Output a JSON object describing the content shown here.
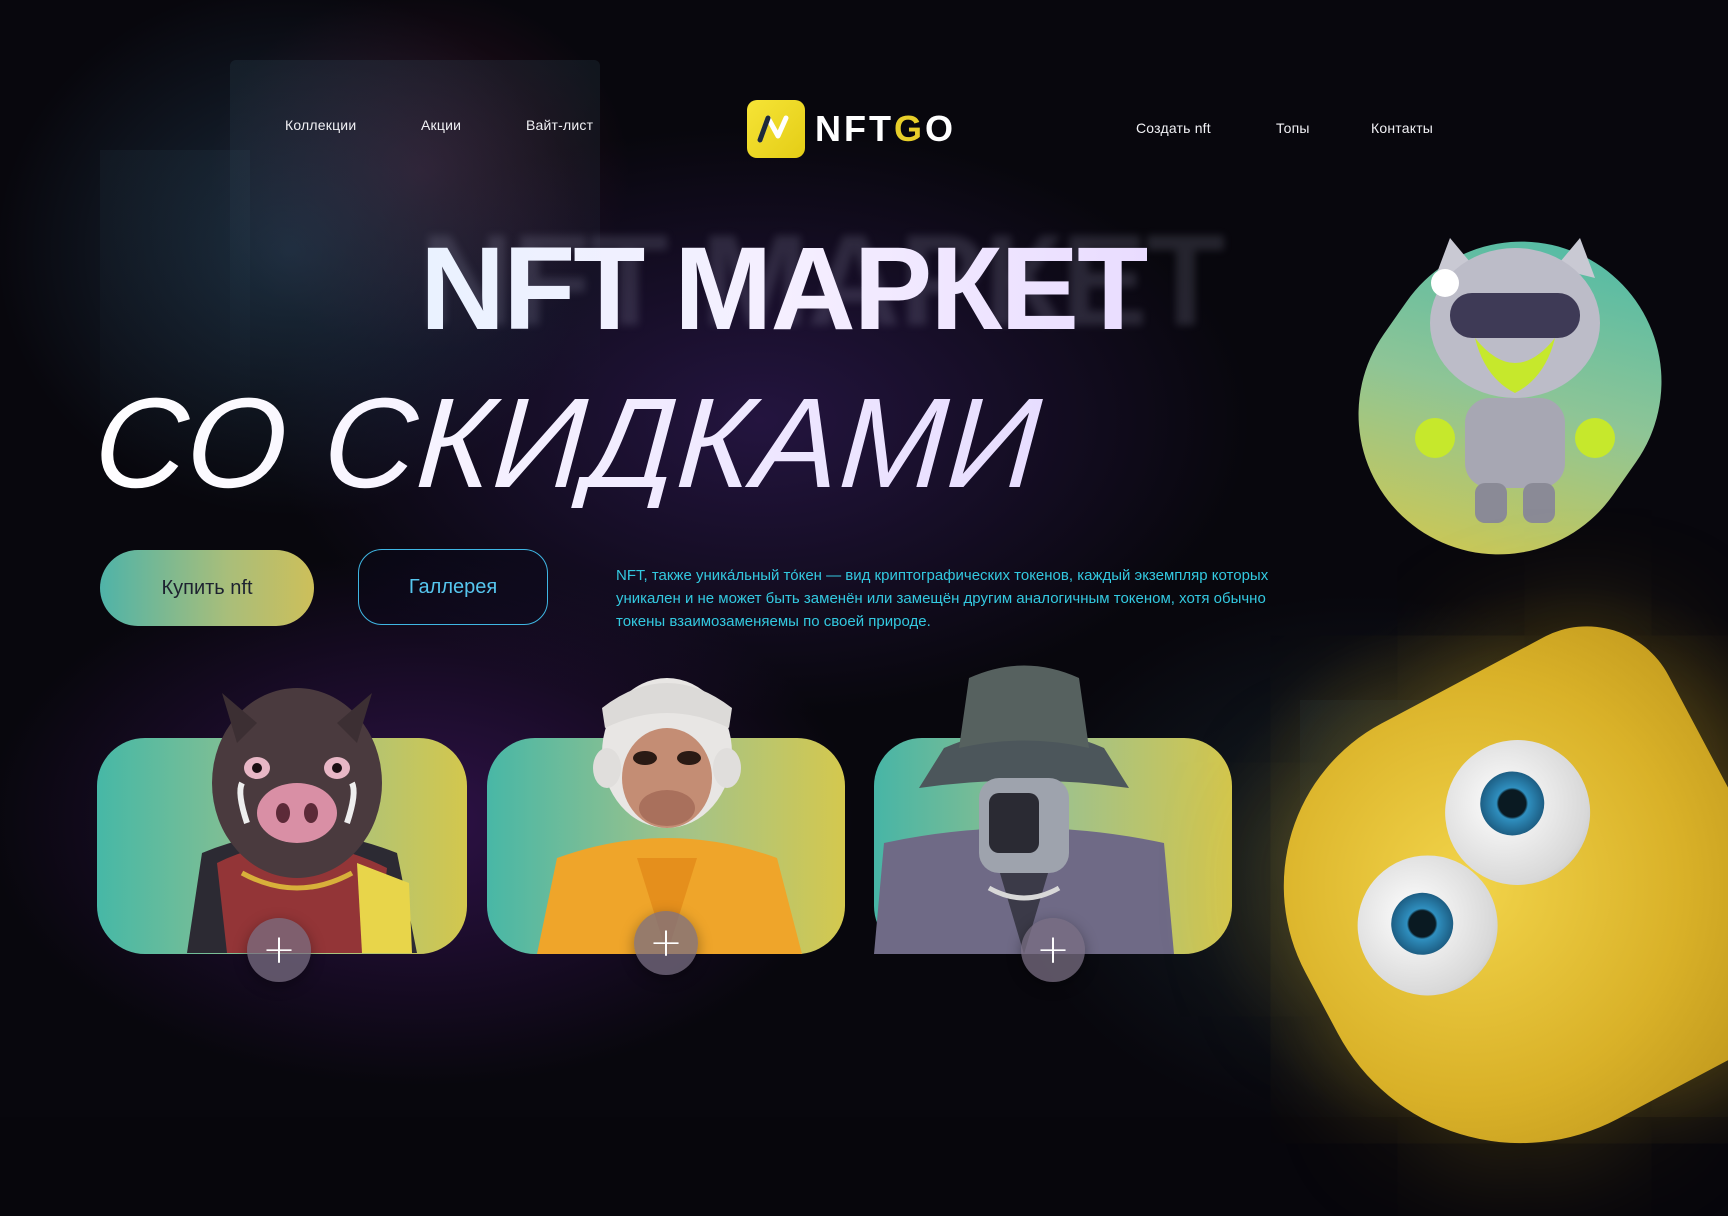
{
  "nav": {
    "left": [
      "Коллекции",
      "Акции",
      "Вайт-лист"
    ],
    "right": [
      "Создать nft",
      "Топы",
      "Контакты"
    ]
  },
  "logo": {
    "mark": "N",
    "text_prefix": "NFT",
    "text_g": "G",
    "text_suffix": "O",
    "accent": "#E8CF2A"
  },
  "hero": {
    "title_line1": "NFT МАРКЕТ",
    "title_line2": "СО СКИДКАМИ",
    "buy_label": "Купить nft",
    "gallery_label": "Галлерея",
    "description": "NFT, также уника́льный то́кен — вид криптографических токенов, каждый экземпляр которых уникален и не может быть заменён или замещён другим аналогичным токеном, хотя обычно токены взаимозаменяемы по своей природе."
  },
  "cards": [
    {
      "character": "boar-character",
      "plus": "+"
    },
    {
      "character": "ape-character",
      "plus": "+"
    },
    {
      "character": "robot-bucket-hat-character",
      "plus": "+"
    }
  ],
  "colors": {
    "accent_cyan": "#33C9E0",
    "accent_yellow": "#E4CD16",
    "card_gradient_start": "#4FB3A8",
    "card_gradient_end": "#D6C84A"
  }
}
